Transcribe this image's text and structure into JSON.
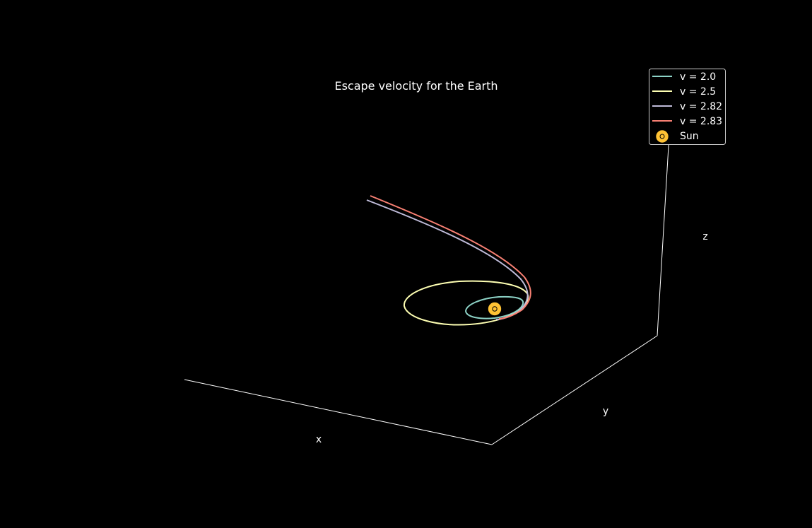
{
  "chart_data": {
    "type": "line",
    "projection": "3d",
    "title": "Escape velocity for the Earth",
    "xlabel": "x",
    "ylabel": "y",
    "zlabel": "z",
    "ticks": "none",
    "grid": false,
    "background": "#000000",
    "legend": {
      "placement": "top-right",
      "entries": [
        {
          "label": "v = 2.0",
          "color": "#8dd3c7",
          "kind": "line"
        },
        {
          "label": "v = 2.5",
          "color": "#feffb3",
          "kind": "line"
        },
        {
          "label": "v = 2.82",
          "color": "#bfbbd9",
          "kind": "line"
        },
        {
          "label": "v = 2.83",
          "color": "#fa8174",
          "kind": "line"
        },
        {
          "label": "Sun",
          "color": "#ffc234",
          "kind": "marker",
          "icon": "sun-icon"
        }
      ]
    },
    "series": [
      {
        "name": "v = 2.0",
        "trajectory": "closed-orbit",
        "color": "#8dd3c7"
      },
      {
        "name": "v = 2.5",
        "trajectory": "closed-orbit",
        "color": "#feffb3"
      },
      {
        "name": "v = 2.82",
        "trajectory": "escape",
        "color": "#bfbbd9"
      },
      {
        "name": "v = 2.83",
        "trajectory": "escape",
        "color": "#fa8174"
      }
    ],
    "sun": {
      "name": "Sun",
      "color": "#ffc234"
    }
  }
}
